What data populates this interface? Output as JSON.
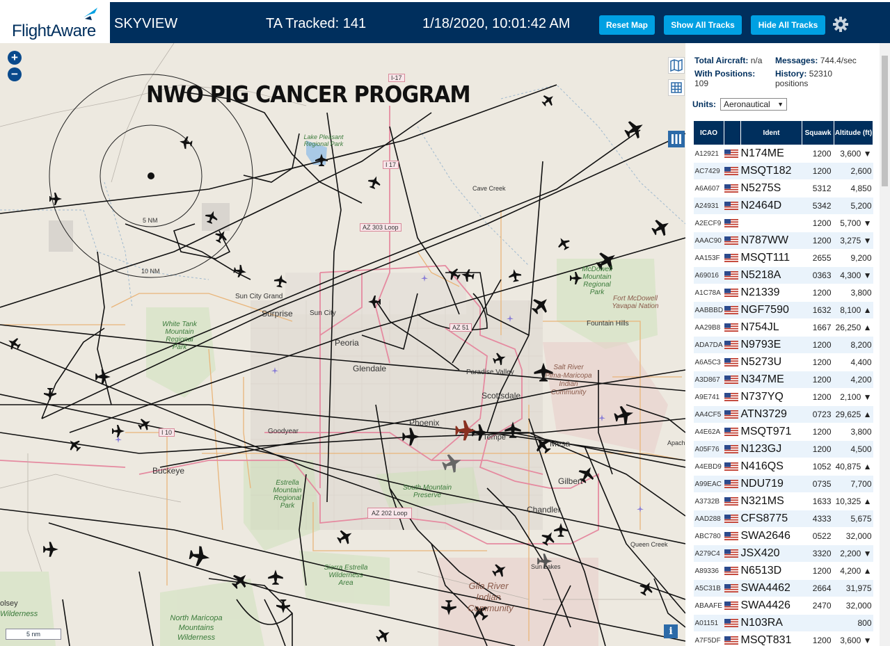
{
  "header": {
    "logo_text": "FlightAware",
    "app_title": "SKYVIEW",
    "tracked": "TA Tracked: 141",
    "datetime": "1/18/2020, 10:01:42 AM",
    "buttons": {
      "reset": "Reset Map",
      "show": "Show All Tracks",
      "hide": "Hide All Tracks"
    },
    "settings_icon": "gear-icon",
    "colors": {
      "bar": "#002f5d",
      "button": "#00a0e2"
    }
  },
  "map": {
    "overlay_title": "NWO PIG CANCER PROGRAM",
    "zoom_in": "+",
    "zoom_out": "−",
    "scale": "5 nm",
    "info": "i",
    "range_labels": [
      "5 NM",
      "10 NM"
    ],
    "places": [
      "Sun City Grand",
      "Surprise",
      "Sun City",
      "Peoria",
      "Glendale",
      "Phoenix",
      "Tempe",
      "Mesa",
      "Gilbert",
      "Chandler",
      "Scottsdale",
      "Paradise Valley",
      "Fountain Hills",
      "Cave Creek",
      "Goodyear",
      "Buckeye",
      "Queen Creek",
      "Sun Lakes",
      "Apach",
      "olsey"
    ],
    "parks": [
      "Lake Pleasant Regional Park",
      "White Tank Mountain Regional Park",
      "McDowell Mountain Regional Park",
      "Fort McDowell Yavapai Nation",
      "Salt River Pima-Maricopa Indian Community",
      "Estrella Mountain Regional Park",
      "South Mountain Preserve",
      "Sierra Estrella Wilderness Area",
      "Gila River Indian Community",
      "North Maricopa Mountains Wilderness",
      "Wilderness"
    ],
    "roads": [
      "I-17",
      "I 17",
      "AZ 303 Loop",
      "AZ 51",
      "I 10",
      "AZ 202 Loop"
    ]
  },
  "sidebar": {
    "stats": {
      "total_label": "Total Aircraft:",
      "total_value": "n/a",
      "messages_label": "Messages:",
      "messages_value": "744.4/sec",
      "positions_label": "With Positions:",
      "positions_value": "109",
      "history_label": "History:",
      "history_value": "52310",
      "history_unit": "positions"
    },
    "units_label": "Units:",
    "units_value": "Aeronautical",
    "columns": [
      "ICAO",
      "",
      "Ident",
      "Squawk",
      "Altitude (ft)"
    ],
    "rows": [
      {
        "icao": "A12921",
        "ident": "N174ME",
        "squawk": "1200",
        "alt": "3,600 ▼"
      },
      {
        "icao": "AC7429",
        "ident": "MSQT182",
        "squawk": "1200",
        "alt": "2,600"
      },
      {
        "icao": "A6A607",
        "ident": "N5275S",
        "squawk": "5312",
        "alt": "4,850"
      },
      {
        "icao": "A24931",
        "ident": "N2464D",
        "squawk": "5342",
        "alt": "5,200"
      },
      {
        "icao": "A2ECF9",
        "ident": "",
        "squawk": "1200",
        "alt": "5,700 ▼"
      },
      {
        "icao": "AAAC90",
        "ident": "N787WW",
        "squawk": "1200",
        "alt": "3,275 ▼"
      },
      {
        "icao": "AA153F",
        "ident": "MSQT111",
        "squawk": "2655",
        "alt": "9,200"
      },
      {
        "icao": "A69016",
        "ident": "N5218A",
        "squawk": "0363",
        "alt": "4,300 ▼"
      },
      {
        "icao": "A1C78A",
        "ident": "N21339",
        "squawk": "1200",
        "alt": "3,800"
      },
      {
        "icao": "AABBBD",
        "ident": "NGF7590",
        "squawk": "1632",
        "alt": "8,100 ▲"
      },
      {
        "icao": "AA29B8",
        "ident": "N754JL",
        "squawk": "1667",
        "alt": "26,250 ▲"
      },
      {
        "icao": "ADA7DA",
        "ident": "N9793E",
        "squawk": "1200",
        "alt": "8,200"
      },
      {
        "icao": "A6A5C3",
        "ident": "N5273U",
        "squawk": "1200",
        "alt": "4,400"
      },
      {
        "icao": "A3D867",
        "ident": "N347ME",
        "squawk": "1200",
        "alt": "4,200"
      },
      {
        "icao": "A9E741",
        "ident": "N737YQ",
        "squawk": "1200",
        "alt": "2,100 ▼"
      },
      {
        "icao": "AA4CF5",
        "ident": "ATN3729",
        "squawk": "0723",
        "alt": "29,625 ▲"
      },
      {
        "icao": "A4E62A",
        "ident": "MSQT971",
        "squawk": "1200",
        "alt": "3,800"
      },
      {
        "icao": "A05F76",
        "ident": "N123GJ",
        "squawk": "1200",
        "alt": "4,500"
      },
      {
        "icao": "A4EBD9",
        "ident": "N416QS",
        "squawk": "1052",
        "alt": "40,875 ▲"
      },
      {
        "icao": "A99EAC",
        "ident": "NDU719",
        "squawk": "0735",
        "alt": "7,700"
      },
      {
        "icao": "A3732B",
        "ident": "N321MS",
        "squawk": "1633",
        "alt": "10,325 ▲"
      },
      {
        "icao": "AAD288",
        "ident": "CFS8775",
        "squawk": "4333",
        "alt": "5,675"
      },
      {
        "icao": "ABC780",
        "ident": "SWA2646",
        "squawk": "0522",
        "alt": "32,000"
      },
      {
        "icao": "A279C4",
        "ident": "JSX420",
        "squawk": "3320",
        "alt": "2,200 ▼"
      },
      {
        "icao": "A89336",
        "ident": "N6513D",
        "squawk": "1200",
        "alt": "4,200 ▲"
      },
      {
        "icao": "A5C31B",
        "ident": "SWA4462",
        "squawk": "2664",
        "alt": "31,975"
      },
      {
        "icao": "ABAAFE",
        "ident": "SWA4426",
        "squawk": "2470",
        "alt": "32,000"
      },
      {
        "icao": "A01151",
        "ident": "N103RA",
        "squawk": "",
        "alt": "800"
      },
      {
        "icao": "A7F5DF",
        "ident": "MSQT831",
        "squawk": "1200",
        "alt": "3,600 ▼"
      }
    ]
  }
}
